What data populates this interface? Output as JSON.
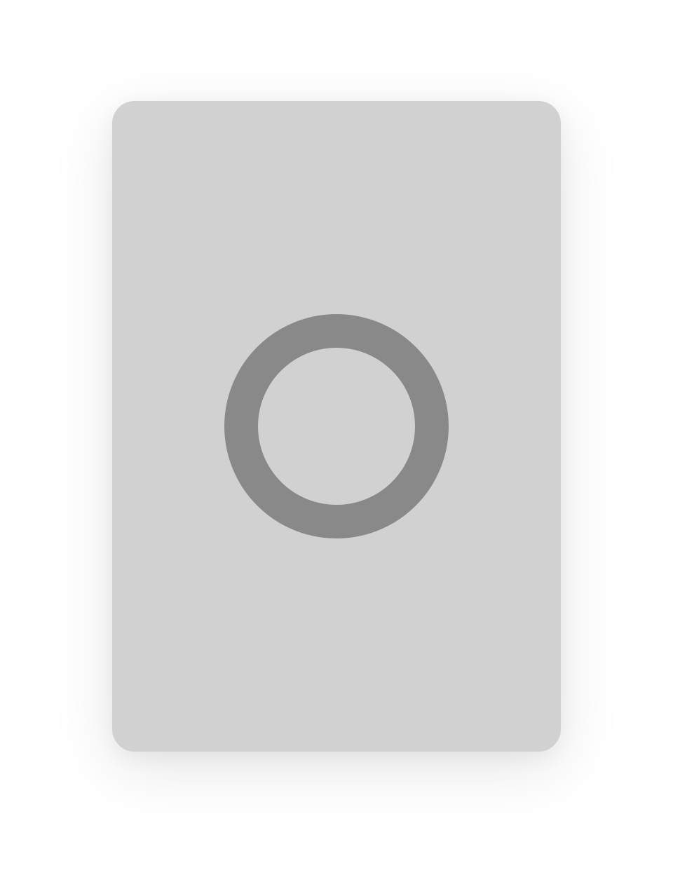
{
  "placeholder": {
    "card_color": "#d1d1d1",
    "icon": "ring-icon",
    "icon_color": "#898989"
  }
}
